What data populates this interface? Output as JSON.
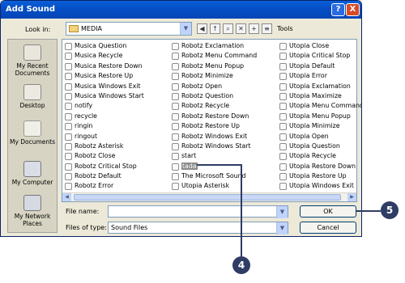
{
  "window": {
    "title": "Add Sound",
    "help_glyph": "?",
    "close_glyph": "X"
  },
  "lookin": {
    "label": "Look in:",
    "value": "MEDIA",
    "tools_label": "Tools"
  },
  "places": [
    {
      "label": "My Recent Documents",
      "icon": "recent-documents-icon"
    },
    {
      "label": "Desktop",
      "icon": "desktop-icon"
    },
    {
      "label": "My Documents",
      "icon": "my-documents-icon"
    },
    {
      "label": "My Computer",
      "icon": "my-computer-icon"
    },
    {
      "label": "My Network Places",
      "icon": "network-places-icon"
    }
  ],
  "files": {
    "col1": [
      "Musica Question",
      "Musica Recycle",
      "Musica Restore Down",
      "Musica Restore Up",
      "Musica Windows Exit",
      "Musica Windows Start",
      "notify",
      "recycle",
      "ringin",
      "ringout",
      "Robotz Asterisk",
      "Robotz Close",
      "Robotz Critical Stop",
      "Robotz Default",
      "Robotz Error"
    ],
    "col2": [
      "Robotz Exclamation",
      "Robotz Menu Command",
      "Robotz Menu Popup",
      "Robotz Minimize",
      "Robotz Open",
      "Robotz Question",
      "Robotz Recycle",
      "Robotz Restore Down",
      "Robotz Restore Up",
      "Robotz Windows Exit",
      "Robotz Windows Start",
      "start",
      "tada",
      "The Microsoft Sound",
      "Utopia Asterisk"
    ],
    "col3": [
      "Utopia Close",
      "Utopia Critical Stop",
      "Utopia Default",
      "Utopia Error",
      "Utopia Exclamation",
      "Utopia Maximize",
      "Utopia Menu Command",
      "Utopia Menu Popup",
      "Utopia Minimize",
      "Utopia Open",
      "Utopia Question",
      "Utopia Recycle",
      "Utopia Restore Down",
      "Utopia Restore Up",
      "Utopia Windows Exit"
    ],
    "selected": "tada"
  },
  "form": {
    "filename_label": "File name:",
    "filename_value": "",
    "filetype_label": "Files of type:",
    "filetype_value": "Sound Files",
    "ok_label": "OK",
    "cancel_label": "Cancel"
  },
  "callouts": {
    "step_ok": "5",
    "step_file": "4"
  },
  "colors": {
    "titlebar": "#0550c7",
    "dialog": "#ece9d8",
    "callout": "#2f3d65",
    "selected": "#8a8a8a"
  }
}
